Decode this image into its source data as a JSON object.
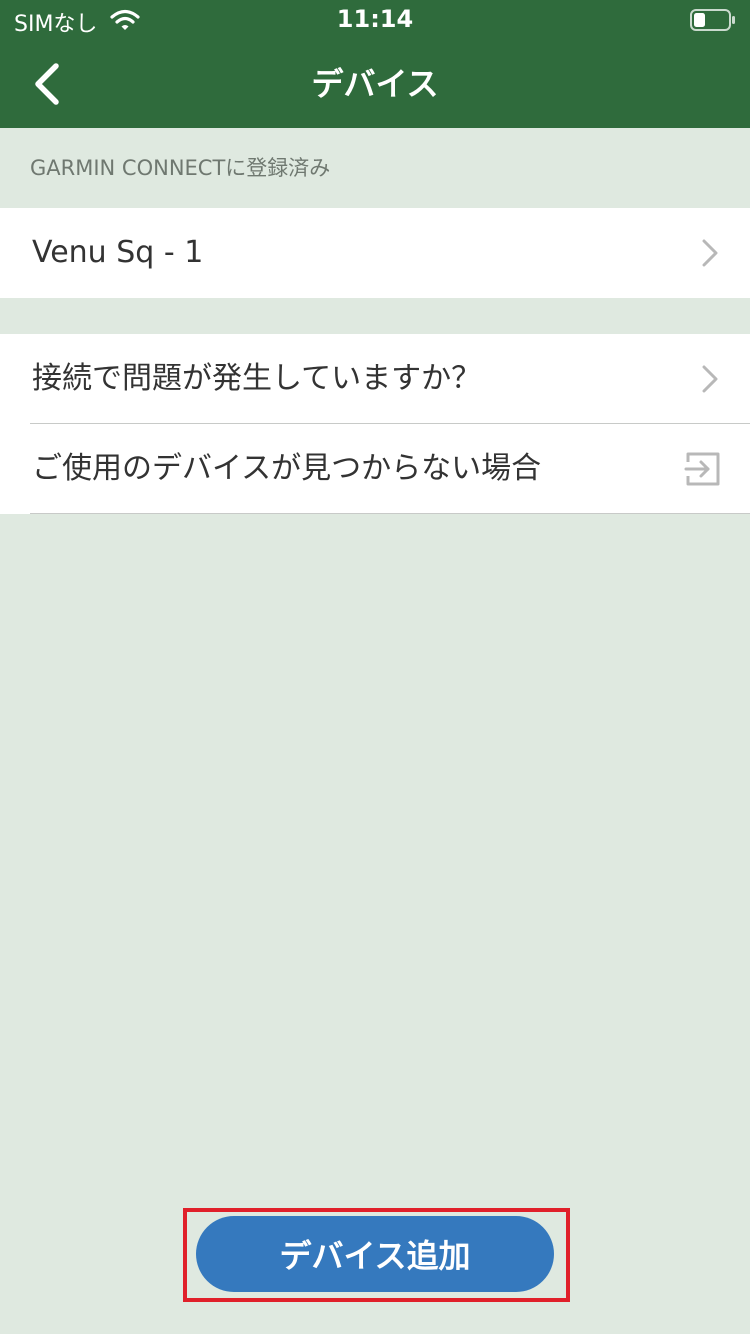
{
  "status_bar": {
    "carrier": "SIMなし",
    "time": "11:14"
  },
  "nav": {
    "title": "デバイス",
    "back_icon": "chevron-left-icon"
  },
  "registered_section": {
    "header": "GARMIN CONNECTに登録済み",
    "devices": [
      {
        "label": "Venu Sq - 1",
        "icon": "chevron-right-icon"
      }
    ]
  },
  "help_section": {
    "items": [
      {
        "label": "接続で問題が発生していますか？",
        "icon": "chevron-right-icon"
      },
      {
        "label": "ご使用のデバイスが見つからない場合",
        "icon": "exit-icon"
      }
    ]
  },
  "add_device_button": {
    "label": "デバイス追加"
  },
  "colors": {
    "header": "#2f6b3c",
    "background": "#dfe9e0",
    "button": "#3579be",
    "highlight": "#e0202a"
  }
}
